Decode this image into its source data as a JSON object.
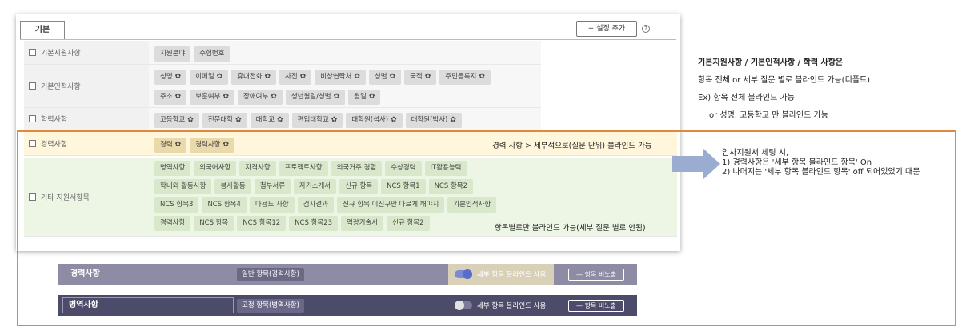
{
  "settings": {
    "tab_label": "기본",
    "add_button": "+ 설정 추가",
    "help_icon": "?",
    "gear": "✿",
    "rows": [
      {
        "label": "기본지원사항",
        "chips": [
          {
            "t": "지원분야"
          },
          {
            "t": "수험번호"
          }
        ]
      },
      {
        "label": "기본인적사항",
        "chips": [
          {
            "t": "성명"
          },
          {
            "t": "이메일"
          },
          {
            "t": "휴대전화"
          },
          {
            "t": "사진"
          },
          {
            "t": "비상연락처"
          },
          {
            "t": "성별"
          },
          {
            "t": "국적"
          },
          {
            "t": "주민등록지"
          },
          {
            "t": "주소"
          },
          {
            "t": "보훈여부"
          },
          {
            "t": "장애여부"
          },
          {
            "t": "생년월일/성별"
          },
          {
            "t": "월일"
          }
        ]
      },
      {
        "label": "학력사항",
        "chips": [
          {
            "t": "고등학교"
          },
          {
            "t": "전문대학"
          },
          {
            "t": "대학교"
          },
          {
            "t": "편입대학교"
          },
          {
            "t": "대학원(석사)"
          },
          {
            "t": "대학원(박사)"
          }
        ]
      },
      {
        "label": "경력사항",
        "chips": [
          {
            "t": "경력"
          },
          {
            "t": "경력사항"
          }
        ]
      },
      {
        "label": "기타 지원서항목",
        "chips": [
          "병역사항",
          "외국어사항",
          "자격사항",
          "프로젝트사항",
          "외국거주 경험",
          "수상경력",
          "IT활용능력",
          "학내외 활동사항",
          "봉사활동",
          "첨부서류",
          "자기소개서",
          "신규 항목",
          "NCS 항목1",
          "NCS 항목2",
          "NCS 항목3",
          "NCS 항목4",
          "다용도 사항",
          "검사결과",
          "신규 항목 이진구만 다르게 해야지",
          "기본인적사항",
          "경력사항",
          "NCS 항목",
          "NCS 항목12",
          "NCS 항목23",
          "역량기술서",
          "신규 항목2"
        ]
      }
    ],
    "career_note": "경력 사항 > 세부적으로(질문 단위) 블라인드 가능",
    "other_note": "항목별로만 블라인드 가능(세부 질문 별로 안됨)"
  },
  "right_notes": {
    "heading": "기본지원사항 / 기본인적사항 / 학력 사항은",
    "line1": "항목 전체 or 세부 질문 별로 블라인드 가능(디폴트)",
    "line2": "Ex) 항목 전체 블라인드 가능",
    "line3": "or 성명, 고등학교 만 블라인드 가능"
  },
  "side_note": {
    "line1": "입사지원서 세팅 시,",
    "line2": "1) 경력사항은 '세부 항목 블라인드 항목' On",
    "line3": "2) 나머지는 '세부 항목 블라인드 항목' off 되어있었기 때문"
  },
  "bars": {
    "career": {
      "title": "경력사항",
      "tag": "일반 항목(경력사항)",
      "toggle_label": "세부 항목 블라인드 사용",
      "hide": "— 항목 비노출",
      "toggle_on": true
    },
    "military": {
      "title": "병역사항",
      "tag": "고정 항목(병역사항)",
      "toggle_label": "세부 항목 블라인드 사용",
      "hide": "— 항목 비노출",
      "toggle_on": false
    }
  }
}
